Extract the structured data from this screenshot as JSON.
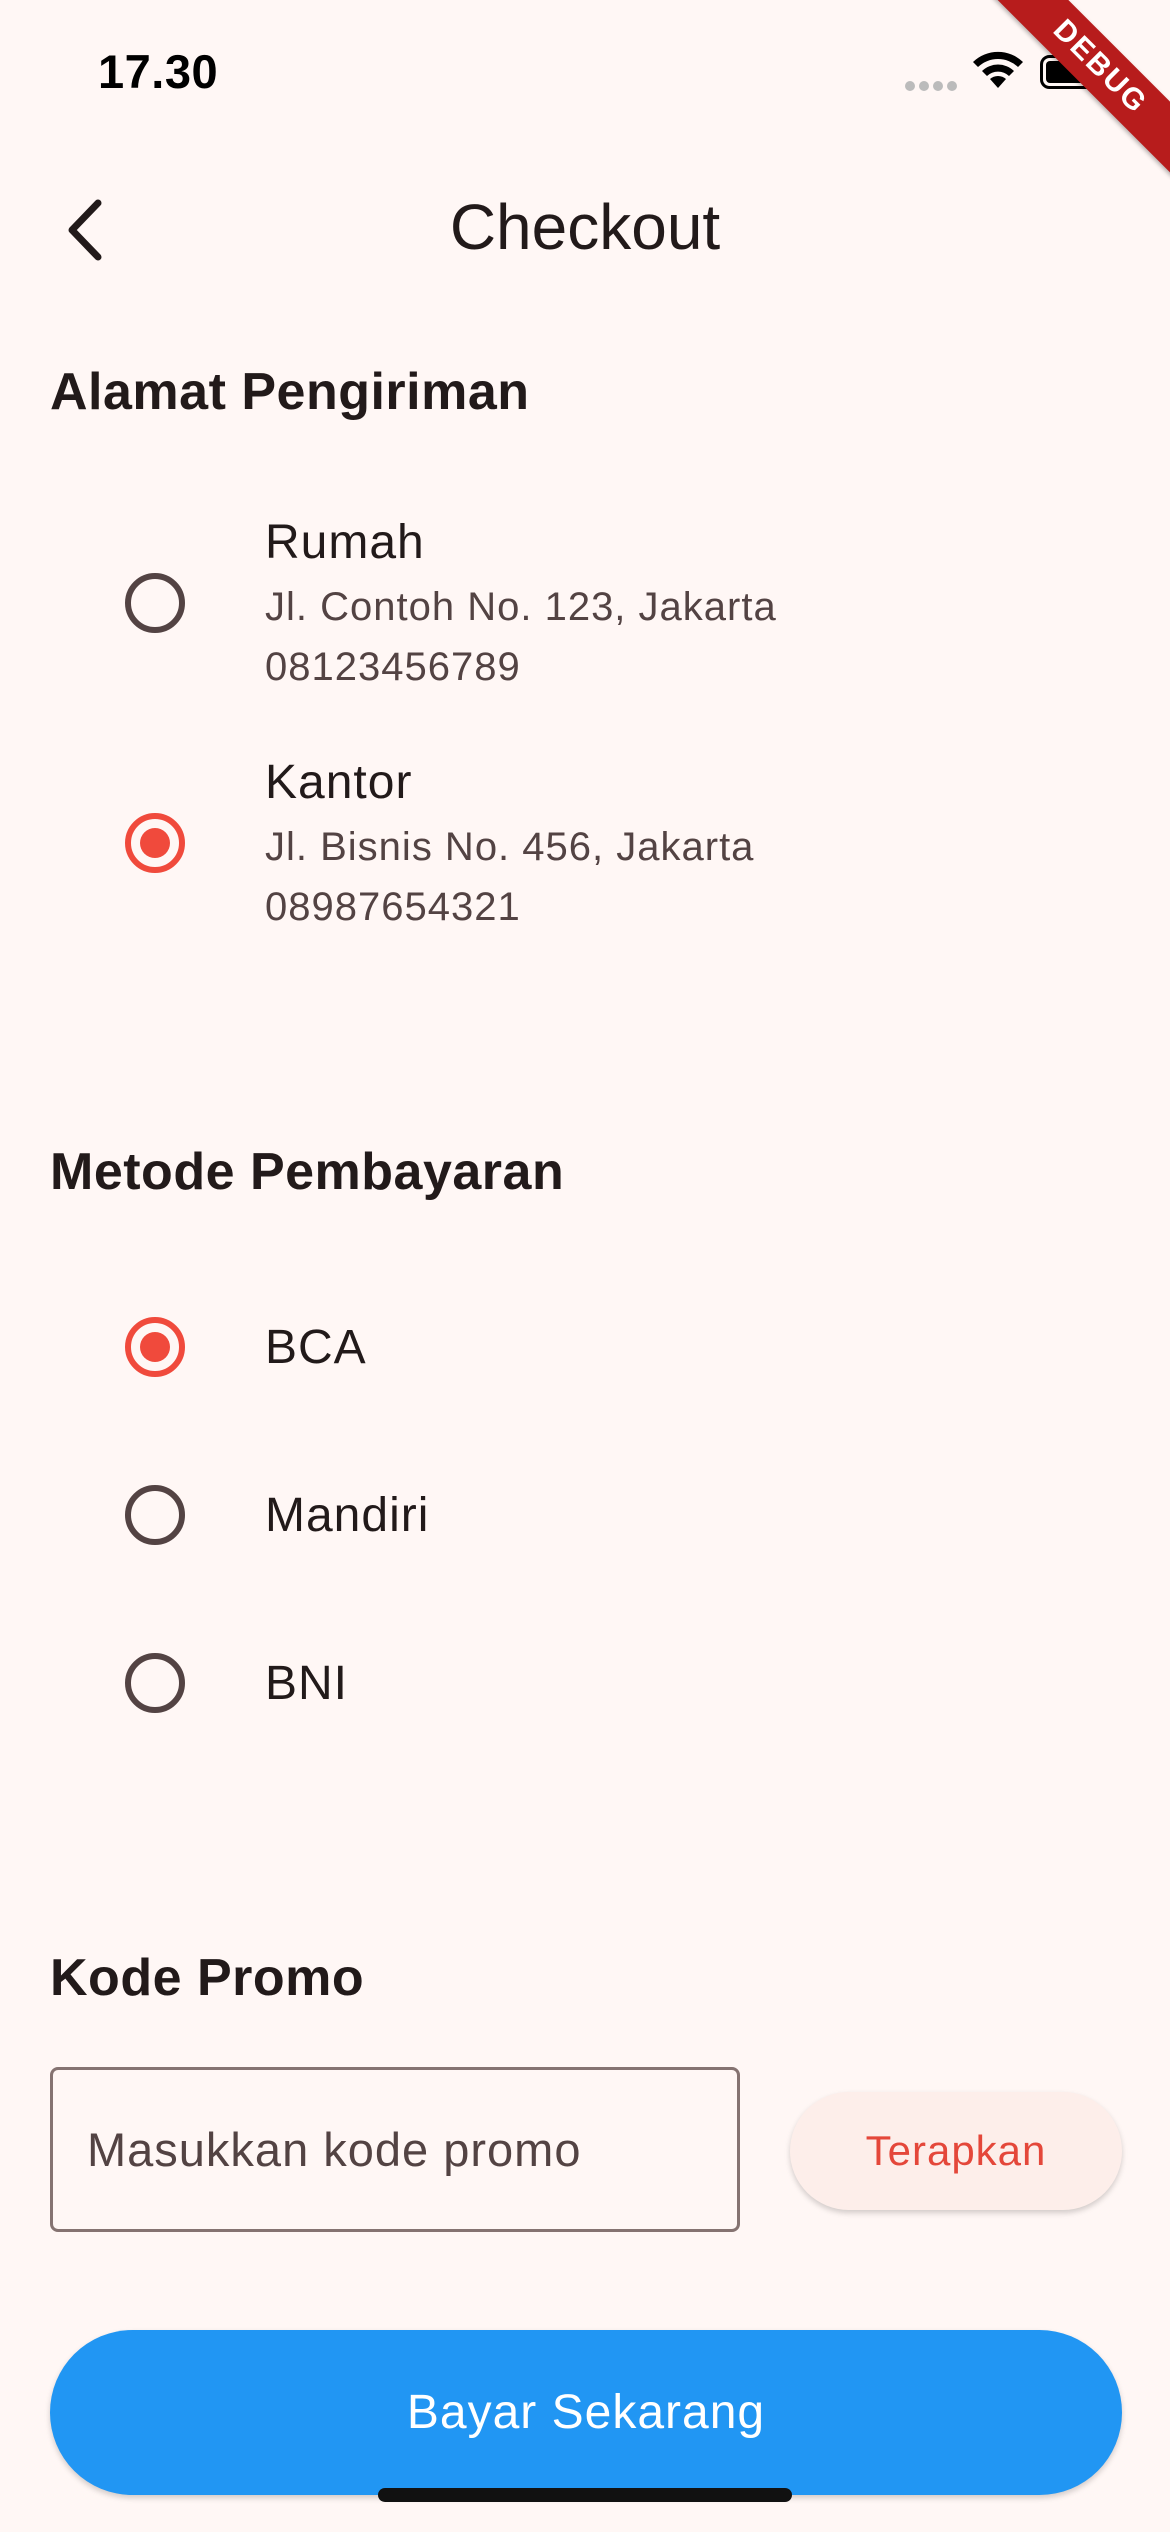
{
  "status_bar": {
    "time": "17.30",
    "icons": [
      "signal-icon",
      "wifi-icon",
      "battery-icon"
    ]
  },
  "debug_banner": "DEBUG",
  "app_bar": {
    "back_icon": "chevron-left-icon",
    "title": "Checkout"
  },
  "shipping": {
    "heading": "Alamat Pengiriman",
    "selected_index": 1,
    "options": [
      {
        "label": "Rumah",
        "address": "Jl. Contoh No. 123, Jakarta",
        "phone": "08123456789"
      },
      {
        "label": "Kantor",
        "address": "Jl. Bisnis No. 456, Jakarta",
        "phone": "08987654321"
      }
    ]
  },
  "payment": {
    "heading": "Metode Pembayaran",
    "selected_index": 0,
    "options": [
      {
        "label": "BCA"
      },
      {
        "label": "Mandiri"
      },
      {
        "label": "BNI"
      }
    ]
  },
  "promo": {
    "heading": "Kode Promo",
    "input_value": "",
    "input_placeholder": "Masukkan kode promo",
    "apply_label": "Terapkan"
  },
  "pay_button_label": "Bayar Sekarang",
  "colors": {
    "background": "#FFF7F5",
    "accent": "#F04A3C",
    "primary_button": "#2196F3",
    "text": "#221A1A"
  }
}
